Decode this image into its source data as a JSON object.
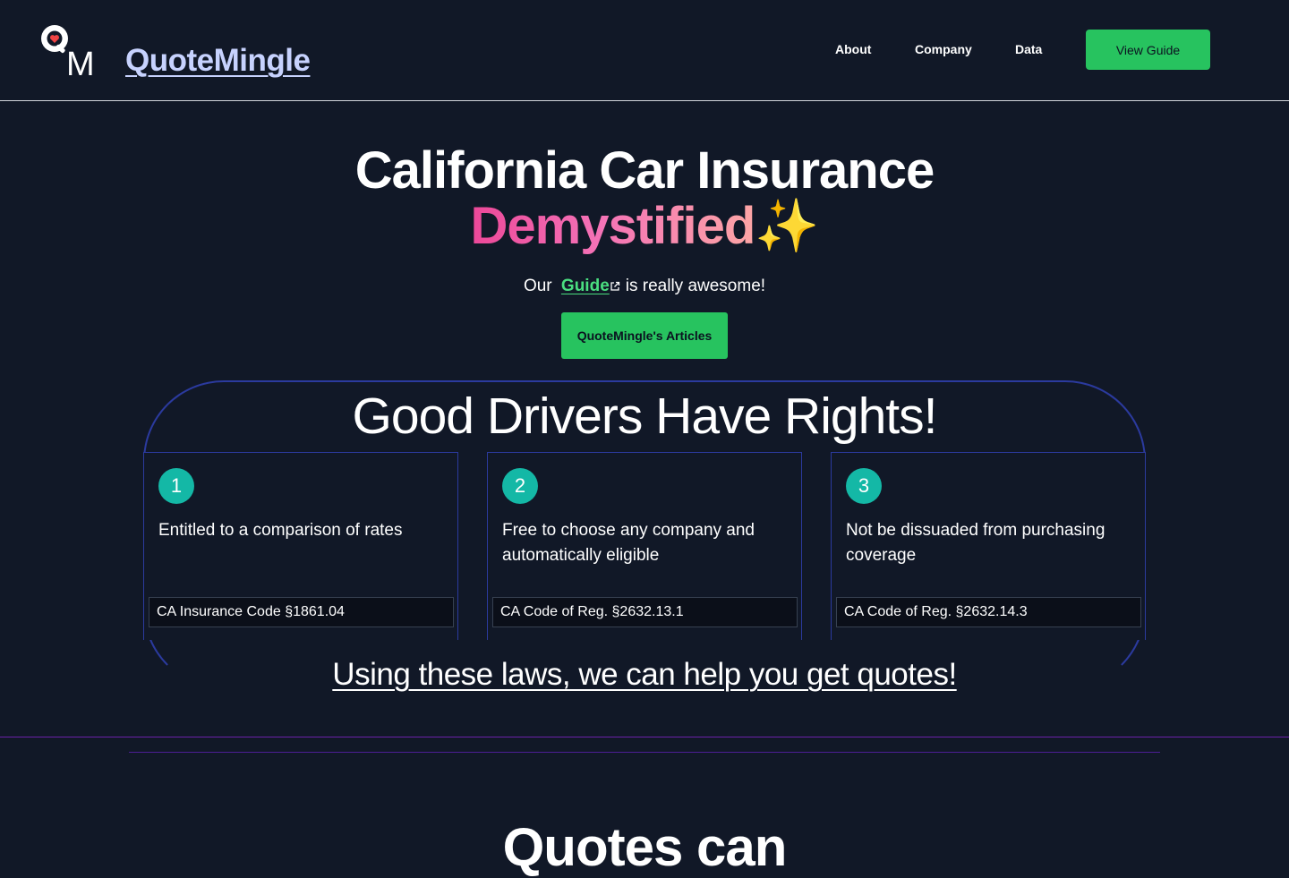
{
  "header": {
    "logo_letters": [
      "Q",
      "M"
    ],
    "brand": "QuoteMingle",
    "nav": {
      "about": "About",
      "company": "Company",
      "data": "Data"
    },
    "cta": "View Guide"
  },
  "hero": {
    "title_line1": "California Car Insurance",
    "title_line2": "Demystified",
    "sparkle": "✨",
    "sub_before": "Our",
    "sub_link": "Guide",
    "sub_after": "is really awesome!",
    "articles_button": "QuoteMingle's Articles"
  },
  "rights": {
    "title": "Good Drivers Have Rights!",
    "cards": [
      {
        "num": "1",
        "text": "Entitled to a comparison of rates",
        "code": "CA Insurance Code §1861.04"
      },
      {
        "num": "2",
        "text": "Free to choose any company and automatically eligible",
        "code": "CA Code of Reg. §2632.13.1"
      },
      {
        "num": "3",
        "text": "Not be dissuaded from purchasing coverage",
        "code": "CA Code of Reg. §2632.14.3"
      }
    ],
    "cta_link": "Using these laws, we can help you get quotes!"
  },
  "next_section": {
    "title": "Quotes can"
  },
  "colors": {
    "background": "#111827",
    "accent_green": "#27c35f",
    "link_green": "#4ade80",
    "teal": "#14b8a6",
    "frame_blue": "#2b3a9e",
    "pink": "#ec4899"
  }
}
